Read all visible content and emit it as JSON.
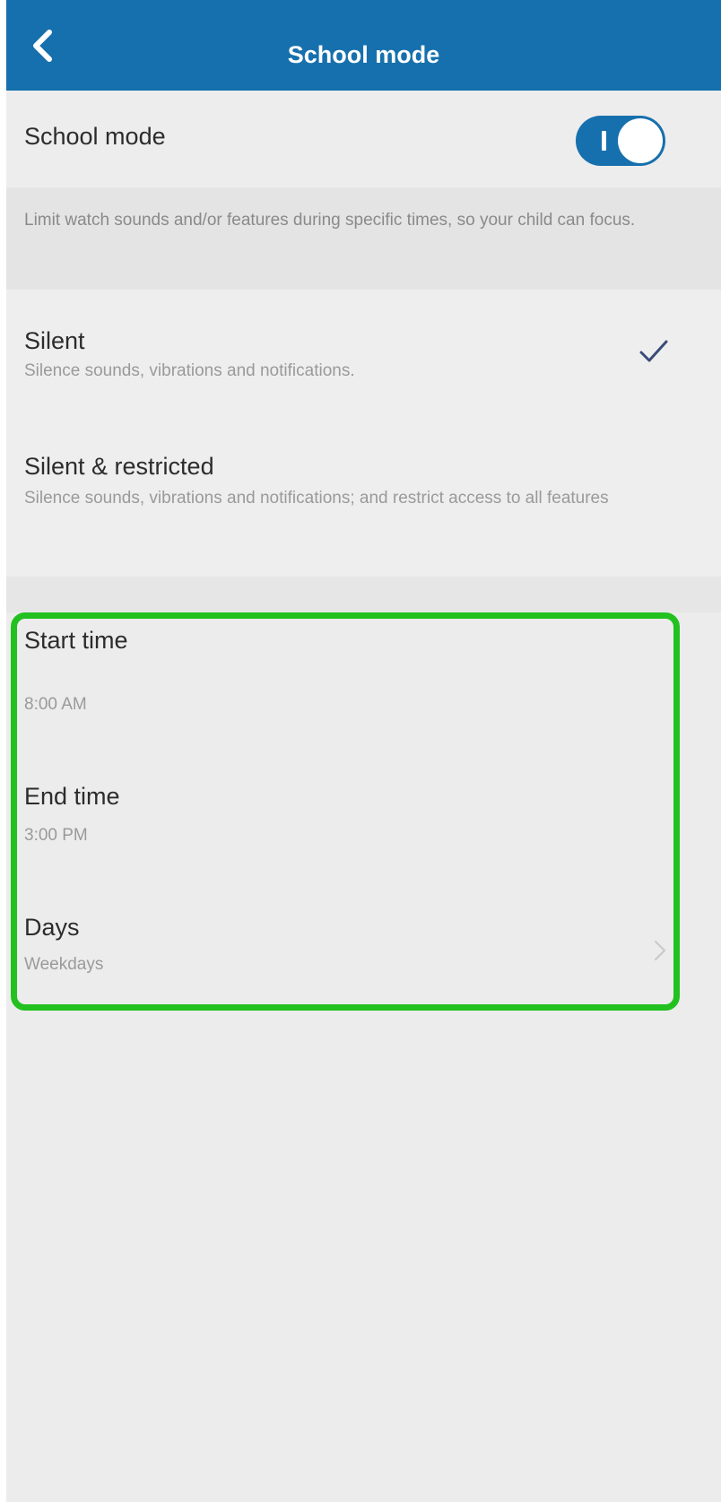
{
  "header": {
    "title": "School mode",
    "back_icon": "chevron-left-icon",
    "background_color": "#1670ad"
  },
  "school_mode": {
    "label": "School mode",
    "toggle_state": "on",
    "toggle_glyph": "I",
    "toggle_color": "#1670ad"
  },
  "description": "Limit watch sounds and/or features during specific times, so your child can focus.",
  "options": [
    {
      "title": "Silent",
      "subtitle": "Silence sounds, vibrations and notifications.",
      "selected": true
    },
    {
      "title": "Silent & restricted",
      "subtitle": "Silence sounds, vibrations and notifications; and restrict access to all features",
      "selected": false
    }
  ],
  "schedule": {
    "start_time": {
      "label": "Start time",
      "value": "8:00 AM"
    },
    "end_time": {
      "label": "End time",
      "value": "3:00 PM"
    },
    "days": {
      "label": "Days",
      "value": "Weekdays"
    }
  },
  "highlight_color": "#22c11f",
  "check_color": "#3a4a7a"
}
